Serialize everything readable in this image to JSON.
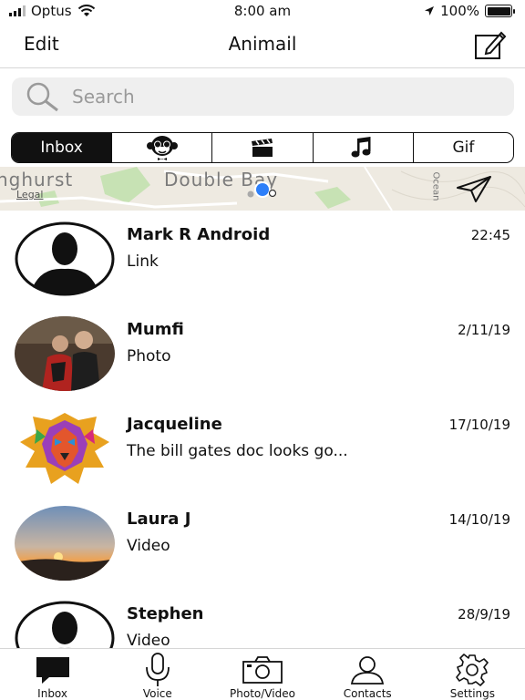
{
  "status": {
    "carrier": "Optus",
    "time": "8:00 am",
    "battery": "100%"
  },
  "navbar": {
    "edit_label": "Edit",
    "title": "Animail"
  },
  "search": {
    "placeholder": "Search"
  },
  "segments": [
    {
      "label": "Inbox",
      "icon": "",
      "active": true
    },
    {
      "label": "",
      "icon": "monkey-icon",
      "active": false
    },
    {
      "label": "",
      "icon": "clapperboard-icon",
      "active": false
    },
    {
      "label": "",
      "icon": "music-note-icon",
      "active": false
    },
    {
      "label": "Gif",
      "icon": "",
      "active": false
    }
  ],
  "map": {
    "place_left": "nghurst",
    "place_center": "Double Bay",
    "legal": "Legal",
    "road": "Ocean"
  },
  "messages": [
    {
      "name": "Mark R Android",
      "time": "22:45",
      "preview": "Link",
      "avatar": "silhouette"
    },
    {
      "name": "Mumfi",
      "time": "2/11/19",
      "preview": "Photo",
      "avatar": "photo-couple"
    },
    {
      "name": "Jacqueline",
      "time": "17/10/19",
      "preview": "The bill gates doc looks go...",
      "avatar": "colorful-lion"
    },
    {
      "name": "Laura J",
      "time": "14/10/19",
      "preview": "Video",
      "avatar": "sunset"
    },
    {
      "name": "Stephen",
      "time": "28/9/19",
      "preview": "Video",
      "avatar": "silhouette"
    }
  ],
  "tabbar": {
    "inbox": "Inbox",
    "voice": "Voice",
    "photo_video": "Photo/Video",
    "contacts": "Contacts",
    "settings": "Settings"
  },
  "colors": {
    "location_blue": "#2d7ff9",
    "park_green": "#c7e2b4",
    "map_bg": "#eeeae1"
  }
}
